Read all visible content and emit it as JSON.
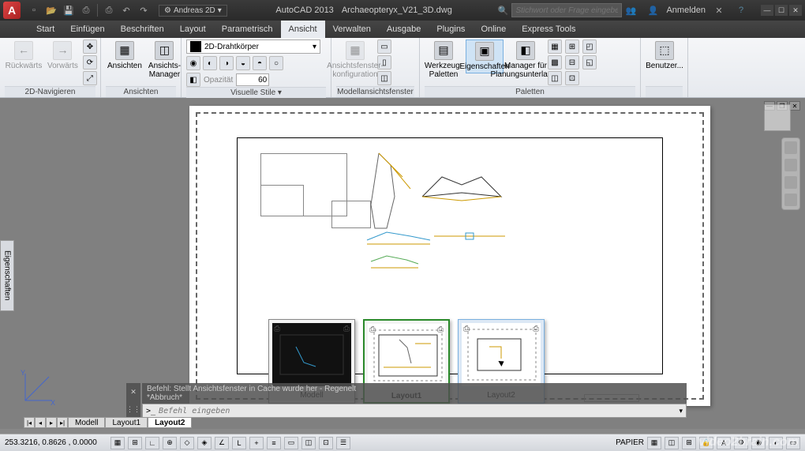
{
  "app": {
    "logo_letter": "A",
    "name": "AutoCAD 2013",
    "doc": "Archaeopteryx_V21_3D.dwg"
  },
  "workspace": {
    "current": "Andreas 2D"
  },
  "search": {
    "placeholder": "Stichwort oder Frage eingeben"
  },
  "user": {
    "login": "Anmelden"
  },
  "menubar": [
    "Start",
    "Einfügen",
    "Beschriften",
    "Layout",
    "Parametrisch",
    "Ansicht",
    "Verwalten",
    "Ausgabe",
    "Plugins",
    "Online",
    "Express Tools"
  ],
  "menubar_active": 5,
  "ribbon": {
    "groups": [
      {
        "title": "2D-Navigieren",
        "buttons": [
          {
            "label": "Rückwärts",
            "icon": "←"
          },
          {
            "label": "Vorwärts",
            "icon": "→"
          }
        ]
      },
      {
        "title": "Ansichten",
        "buttons": [
          {
            "label": "Ansichten",
            "icon": "▦"
          },
          {
            "label": "Ansichts-\nManager",
            "icon": "◫"
          }
        ]
      },
      {
        "title": "Visuelle Stile ▾",
        "dropdown": "2D-Drahtkörper",
        "opacity_label": "Opazität",
        "opacity_value": "60"
      },
      {
        "title": "Modellansichtsfenster",
        "buttons": [
          {
            "label": "Ansichtsfenster-\nkonfiguration",
            "icon": "▦"
          }
        ]
      },
      {
        "title": "Paletten",
        "buttons": [
          {
            "label": "Werkzeug-\nPaletten",
            "icon": "▤"
          },
          {
            "label": "Eigenschaften",
            "icon": "▣",
            "active": true
          },
          {
            "label": "Manager für\nPlanungsunterlagen",
            "icon": "◧"
          }
        ]
      },
      {
        "title": "",
        "buttons": [
          {
            "label": "Benutzer...",
            "icon": "⬚"
          }
        ]
      }
    ]
  },
  "side_panel": "Eigenschaften",
  "quickview": {
    "items": [
      {
        "label": "Modell",
        "dark": true
      },
      {
        "label": "Layout1",
        "selected": true
      },
      {
        "label": "Layout2",
        "highlight": true
      }
    ]
  },
  "command": {
    "history_line1": "Befehl: Stellt Ansichtsfenster in Cache wurde her - Regenelt",
    "history_line2": "*Abbruch*",
    "prompt": ">_",
    "placeholder": "Befehl eingeben"
  },
  "layout_tabs": [
    "Modell",
    "Layout1",
    "Layout2"
  ],
  "layout_tabs_active": 2,
  "status": {
    "coords": "253.3216, 0.8626 , 0.0000",
    "paper": "PAPIER"
  },
  "watermark": "video2brain.com"
}
